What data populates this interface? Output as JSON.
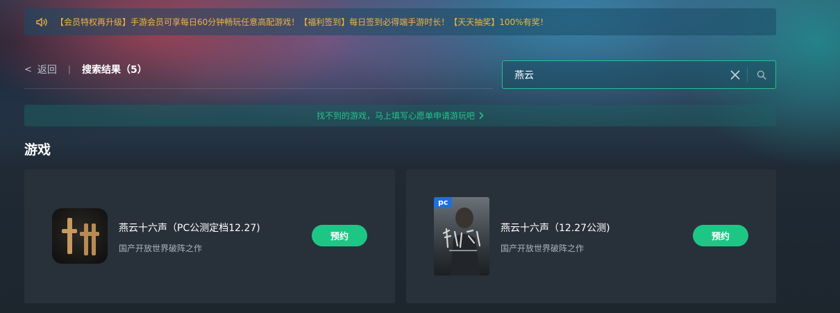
{
  "notice": {
    "icon": "speaker-icon",
    "text": "【会员特权再升级】手游会员可享每日60分钟畅玩任意高配游戏！【福利签到】每日签到必得端手游时长！【天天抽奖】100%有奖！"
  },
  "nav": {
    "back_arrow": "<",
    "back_label": "返回",
    "separator": "|",
    "results_title": "搜索结果（5）"
  },
  "search": {
    "value": "燕云"
  },
  "wish_banner": {
    "text": "找不到的游戏，马上填写心愿单申请游玩吧"
  },
  "section": {
    "title": "游戏"
  },
  "games": [
    {
      "name": "燕云十六声（PC公测定档12.27)",
      "desc": "国产开放世界破阵之作",
      "button": "预约"
    },
    {
      "badge": "pc",
      "name": "燕云十六声（12.27公测)",
      "desc": "国产开放世界破阵之作",
      "button": "预约"
    }
  ],
  "colors": {
    "accent": "#21c48c",
    "notice_text": "#f1b43f",
    "button": "#1ec685",
    "badge": "#1f6fe0"
  }
}
